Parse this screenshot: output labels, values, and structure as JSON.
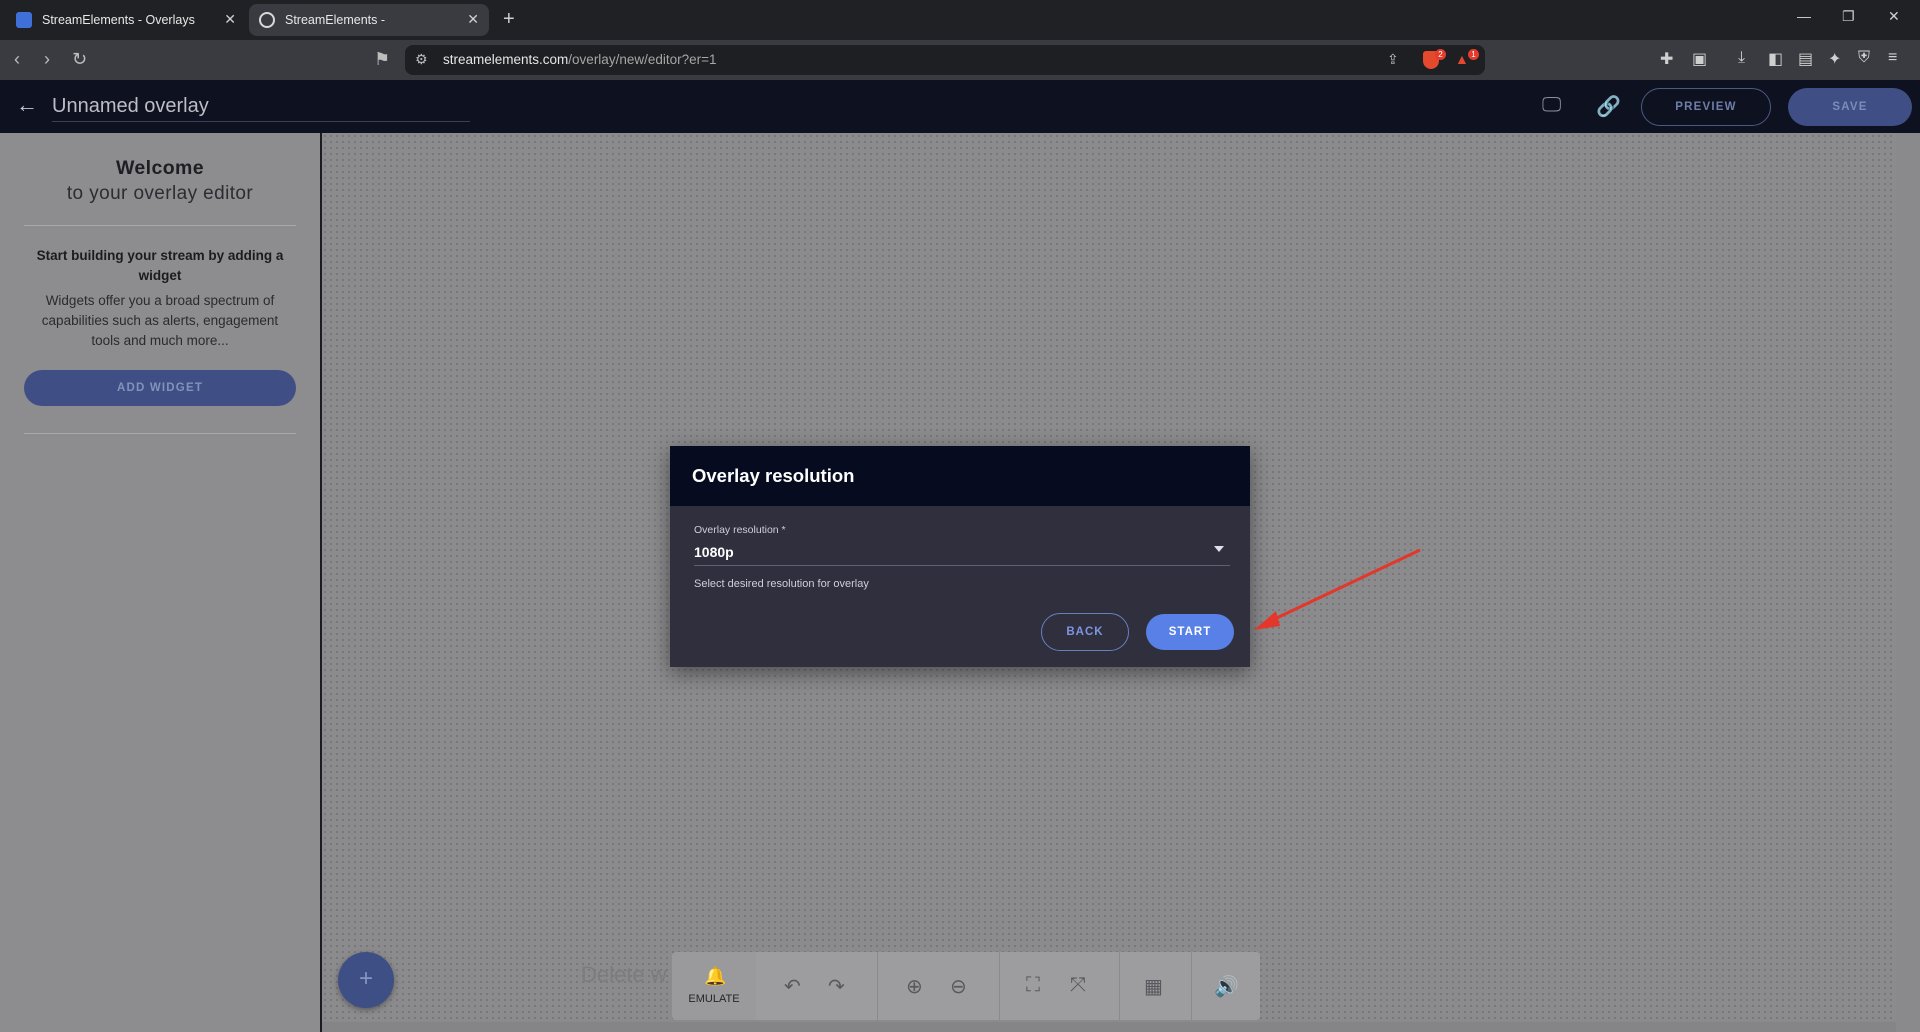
{
  "browser": {
    "tabs": [
      {
        "title": "StreamElements - Overlays",
        "active": false
      },
      {
        "title": "StreamElements -",
        "active": true
      }
    ],
    "new_tab": "+",
    "url_host": "streamelements.com",
    "url_path": "/overlay/new/editor?er=1",
    "brave_badge": "2",
    "alert_badge": "1",
    "accent": "#e5492d"
  },
  "header": {
    "overlay_title": "Unnamed overlay",
    "preview_label": "PREVIEW",
    "save_label": "SAVE"
  },
  "sidebar": {
    "welcome": "Welcome",
    "welcome_sub": "to your overlay editor",
    "start_text": "Start building your stream by adding a widget",
    "widgets_text": "Widgets offer you a broad spectrum of capabilities such as alerts, engagement tools and much more...",
    "add_widget_label": "ADD WIDGET"
  },
  "canvas": {
    "fab_label": "+",
    "delete_hint": "Delete w",
    "emulate_label": "EMULATE"
  },
  "modal": {
    "title": "Overlay resolution",
    "field_label": "Overlay resolution *",
    "selected_value": "1080p",
    "helper_text": "Select desired resolution for overlay",
    "back_label": "BACK",
    "start_label": "START",
    "start_color": "#5880e6"
  }
}
